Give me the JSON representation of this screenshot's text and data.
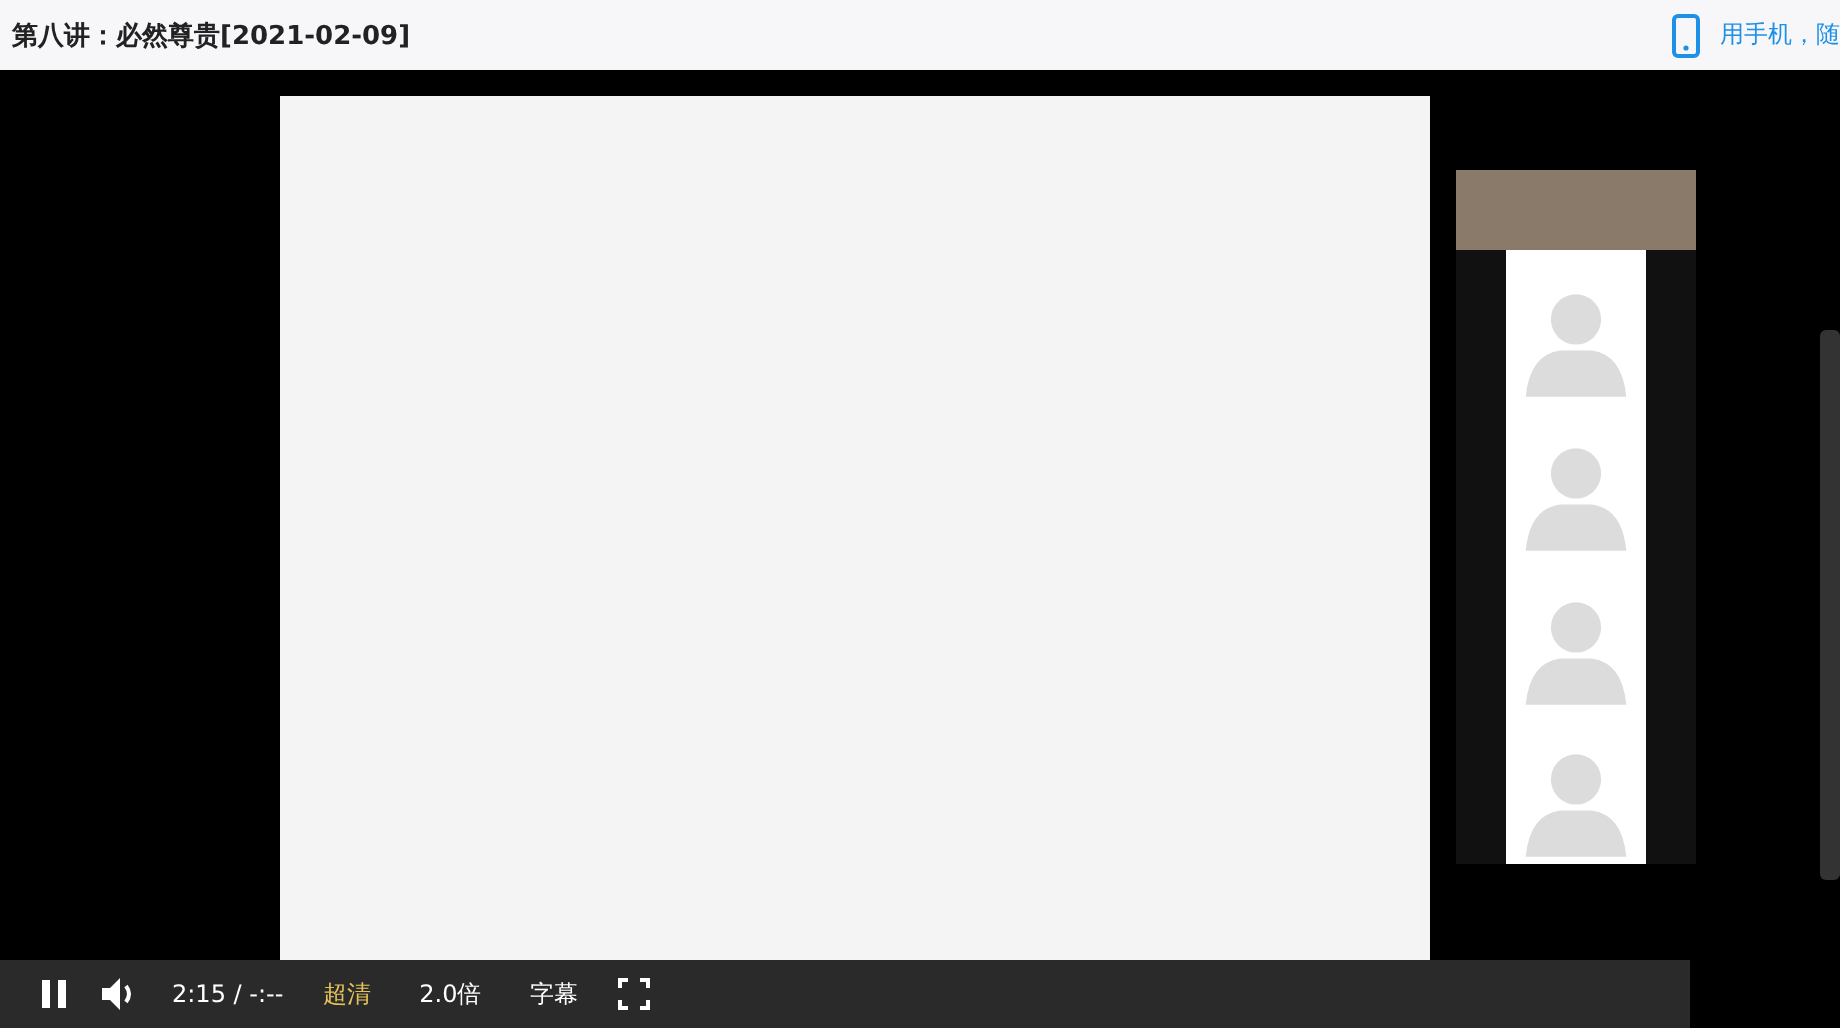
{
  "header": {
    "title": "第八讲：必然尊贵[2021-02-09]",
    "mobile_link": "用手机，随"
  },
  "player": {
    "playing": true,
    "time": "2:15 / -:--",
    "quality": {
      "label": "超清",
      "selected": true
    },
    "speed": "2.0倍",
    "subtitles": "字幕"
  }
}
